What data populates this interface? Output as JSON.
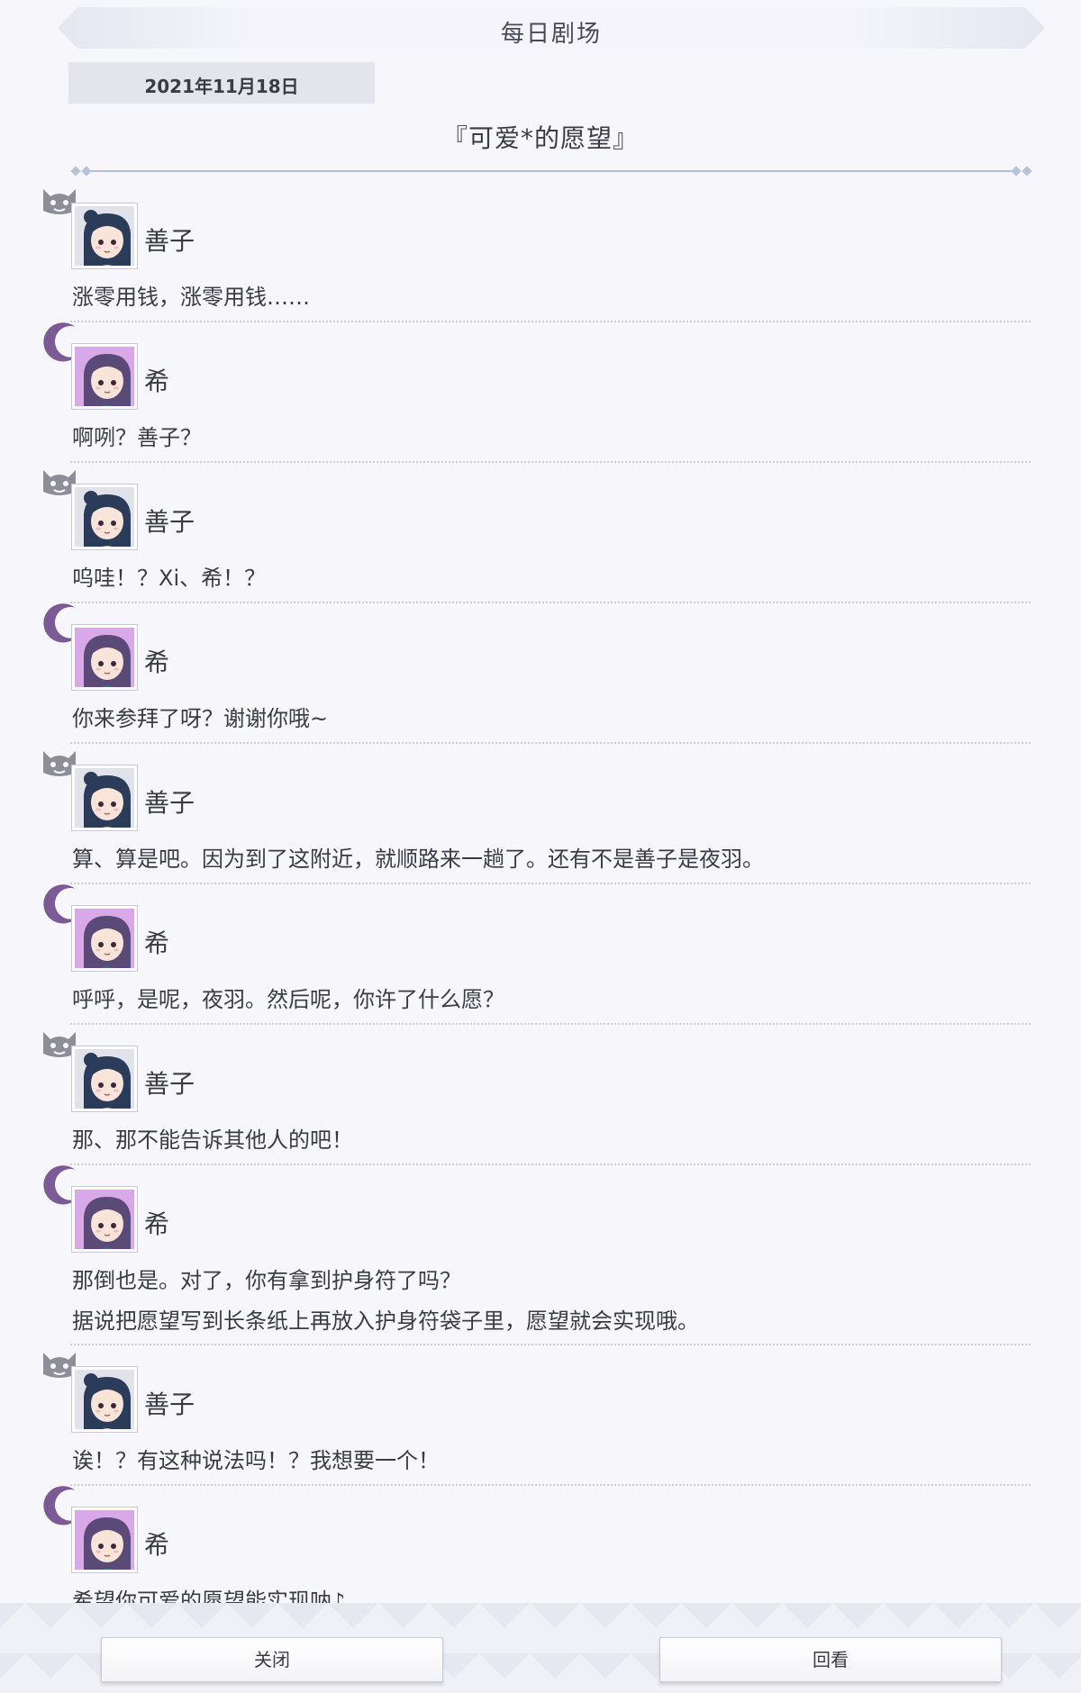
{
  "header": {
    "title": "每日剧场"
  },
  "date": "2021年11月18日",
  "story_title": "『可爱*的愿望』",
  "characters": {
    "yoshiko": {
      "name": "善子",
      "emblem": "devil-icon",
      "frame_color": "#e2e2ea"
    },
    "nozomi": {
      "name": "希",
      "emblem": "crescent-moon-icon",
      "frame_color": "#d8a8e8"
    }
  },
  "dialogues": [
    {
      "speaker": "善子",
      "lines": [
        "涨零用钱，涨零用钱……"
      ]
    },
    {
      "speaker": "希",
      "lines": [
        "啊咧？善子？"
      ]
    },
    {
      "speaker": "善子",
      "lines": [
        "呜哇！？Xi、希！？"
      ]
    },
    {
      "speaker": "希",
      "lines": [
        "你来参拜了呀？谢谢你哦~"
      ]
    },
    {
      "speaker": "善子",
      "lines": [
        "算、算是吧。因为到了这附近，就顺路来一趟了。还有不是善子是夜羽。"
      ]
    },
    {
      "speaker": "希",
      "lines": [
        "呼呼，是呢，夜羽。然后呢，你许了什么愿？"
      ]
    },
    {
      "speaker": "善子",
      "lines": [
        "那、那不能告诉其他人的吧！"
      ]
    },
    {
      "speaker": "希",
      "lines": [
        "那倒也是。对了，你有拿到护身符了吗？",
        "据说把愿望写到长条纸上再放入护身符袋子里，愿望就会实现哦。"
      ]
    },
    {
      "speaker": "善子",
      "lines": [
        "诶！？有这种说法吗！？我想要一个！"
      ]
    },
    {
      "speaker": "希",
      "lines": [
        "希望你可爱的愿望能实现呐♪"
      ]
    }
  ],
  "footer": {
    "close_label": "关闭",
    "review_label": "回看"
  }
}
